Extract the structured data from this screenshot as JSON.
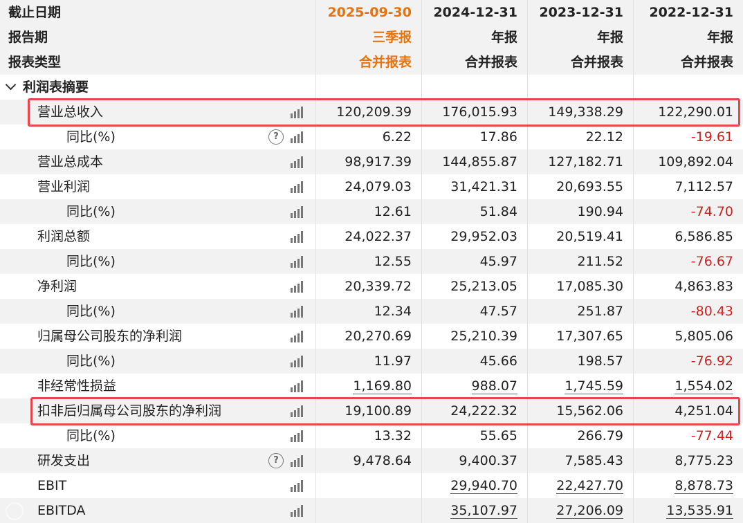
{
  "header": {
    "rows": [
      {
        "label": "截止日期",
        "values": [
          "2025-09-30",
          "2024-12-31",
          "2023-12-31",
          "2022-12-31"
        ]
      },
      {
        "label": "报告期",
        "values": [
          "三季报",
          "年报",
          "年报",
          "年报"
        ]
      },
      {
        "label": "报表类型",
        "values": [
          "合并报表",
          "合并报表",
          "合并报表",
          "合并报表"
        ]
      }
    ]
  },
  "section": {
    "label": "利润表摘要"
  },
  "rows": [
    {
      "label": "营业总收入",
      "level": 1,
      "help": false,
      "values": [
        "120,209.39",
        "176,015.93",
        "149,338.29",
        "122,290.01"
      ]
    },
    {
      "label": "同比(%)",
      "level": 2,
      "help": true,
      "values": [
        "6.22",
        "17.86",
        "22.12",
        "-19.61"
      ]
    },
    {
      "label": "营业总成本",
      "level": 1,
      "help": false,
      "values": [
        "98,917.39",
        "144,855.87",
        "127,182.71",
        "109,892.04"
      ]
    },
    {
      "label": "营业利润",
      "level": 1,
      "help": false,
      "values": [
        "24,079.03",
        "31,421.31",
        "20,693.55",
        "7,112.57"
      ]
    },
    {
      "label": "同比(%)",
      "level": 2,
      "help": false,
      "values": [
        "12.61",
        "51.84",
        "190.94",
        "-74.70"
      ]
    },
    {
      "label": "利润总额",
      "level": 1,
      "help": false,
      "values": [
        "24,022.37",
        "29,952.03",
        "20,519.41",
        "6,586.85"
      ]
    },
    {
      "label": "同比(%)",
      "level": 2,
      "help": false,
      "values": [
        "12.55",
        "45.97",
        "211.52",
        "-76.67"
      ]
    },
    {
      "label": "净利润",
      "level": 1,
      "help": false,
      "values": [
        "20,339.72",
        "25,213.05",
        "17,085.30",
        "4,863.83"
      ]
    },
    {
      "label": "同比(%)",
      "level": 2,
      "help": false,
      "values": [
        "12.34",
        "47.57",
        "251.87",
        "-80.43"
      ]
    },
    {
      "label": "归属母公司股东的净利润",
      "level": 1,
      "help": false,
      "values": [
        "20,270.69",
        "25,210.39",
        "17,307.65",
        "5,805.06"
      ]
    },
    {
      "label": "同比(%)",
      "level": 2,
      "help": false,
      "values": [
        "11.97",
        "45.66",
        "198.57",
        "-76.92"
      ]
    },
    {
      "label": "非经常性损益",
      "level": 1,
      "help": false,
      "underline": true,
      "values": [
        "1,169.80",
        "988.07",
        "1,745.59",
        "1,554.02"
      ]
    },
    {
      "label": "扣非后归属母公司股东的净利润",
      "level": 1,
      "help": false,
      "values": [
        "19,100.89",
        "24,222.32",
        "15,562.06",
        "4,251.04"
      ]
    },
    {
      "label": "同比(%)",
      "level": 2,
      "help": false,
      "values": [
        "13.32",
        "55.65",
        "266.79",
        "-77.44"
      ]
    },
    {
      "label": "研发支出",
      "level": 1,
      "help": true,
      "values": [
        "9,478.64",
        "9,400.37",
        "7,585.43",
        "8,775.23"
      ]
    },
    {
      "label": "EBIT",
      "level": 1,
      "help": false,
      "underline": true,
      "values": [
        "",
        "29,940.70",
        "22,427.70",
        "8,878.73"
      ]
    },
    {
      "label": "EBITDA",
      "level": 1,
      "help": false,
      "underline": true,
      "values": [
        "",
        "35,107.97",
        "27,206.09",
        "13,535.91"
      ]
    }
  ],
  "highlighted_rows": [
    "营业总收入",
    "扣非后归属母公司股东的净利润"
  ],
  "watermark": {
    "text": "",
    "logo_icon": "watermark-logo-icon"
  },
  "colors": {
    "accent_orange": "#e8730c",
    "negative_red": "#d4201d",
    "highlight_border": "#e8454d",
    "row_alt_bg": "#f2f2f2"
  },
  "icons": {
    "chart": "bar-chart-icon",
    "help": "help-icon",
    "collapse": "chevron-down-icon"
  }
}
